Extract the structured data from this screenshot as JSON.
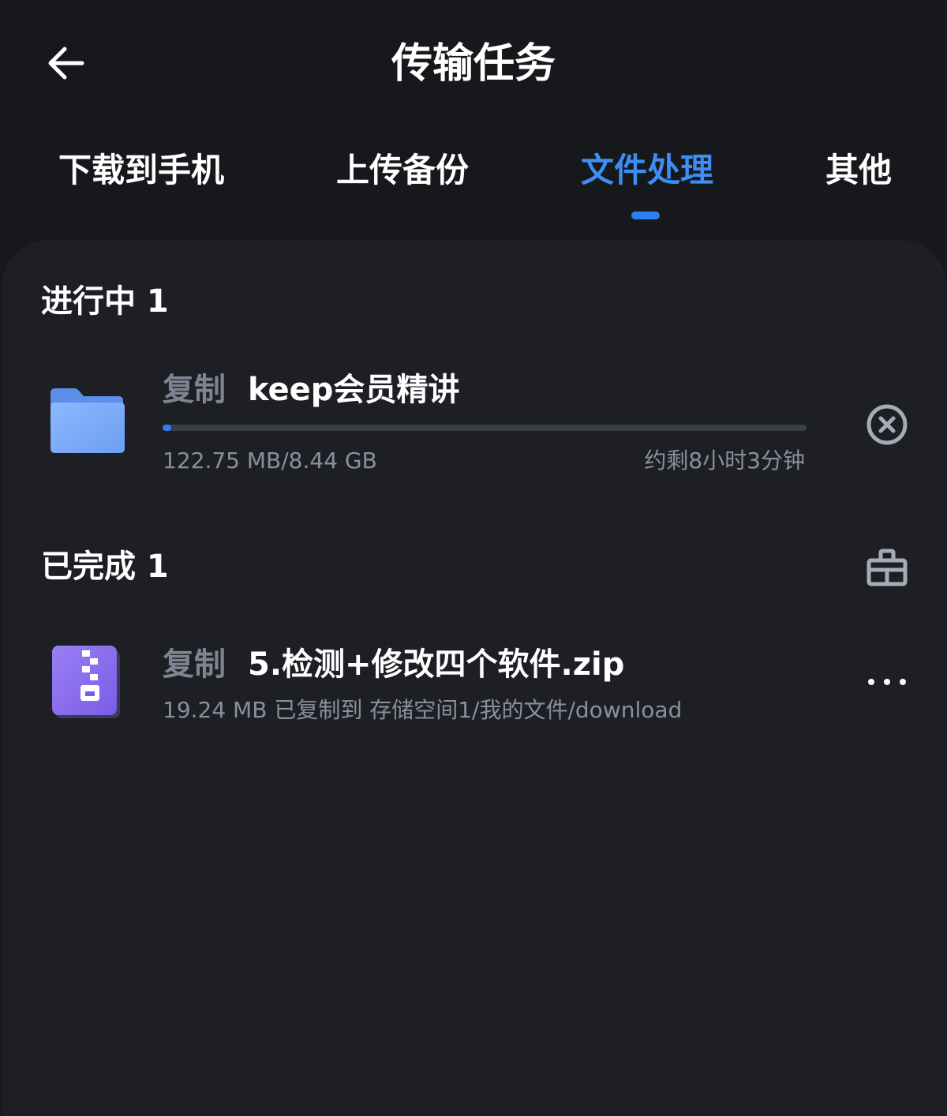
{
  "header": {
    "title": "传输任务",
    "back_icon": "arrow-left-icon"
  },
  "tabs": [
    {
      "label": "下载到手机",
      "active": false
    },
    {
      "label": "上传备份",
      "active": false
    },
    {
      "label": "文件处理",
      "active": true
    },
    {
      "label": "其他",
      "active": false
    }
  ],
  "in_progress": {
    "title": "进行中 1",
    "item": {
      "operation": "复制",
      "name": "keep会员精讲",
      "icon": "folder-icon",
      "size_progress": "122.75 MB/8.44 GB",
      "remaining": "约剩8小时3分钟",
      "progress_fraction": 0.014,
      "action_icon": "cancel-circle-icon"
    }
  },
  "completed": {
    "title": "已完成 1",
    "clear_icon": "broom-clear-icon",
    "item": {
      "operation": "复制",
      "name": "5.检测+修改四个软件.zip",
      "icon": "zip-archive-icon",
      "detail": "19.24 MB 已复制到 存储空间1/我的文件/download",
      "more_icon": "more-dots-icon"
    }
  },
  "colors": {
    "background": "#16181c",
    "panel": "#1d1f25",
    "accent": "#2f7ff0",
    "muted_text": "#8a909b"
  }
}
